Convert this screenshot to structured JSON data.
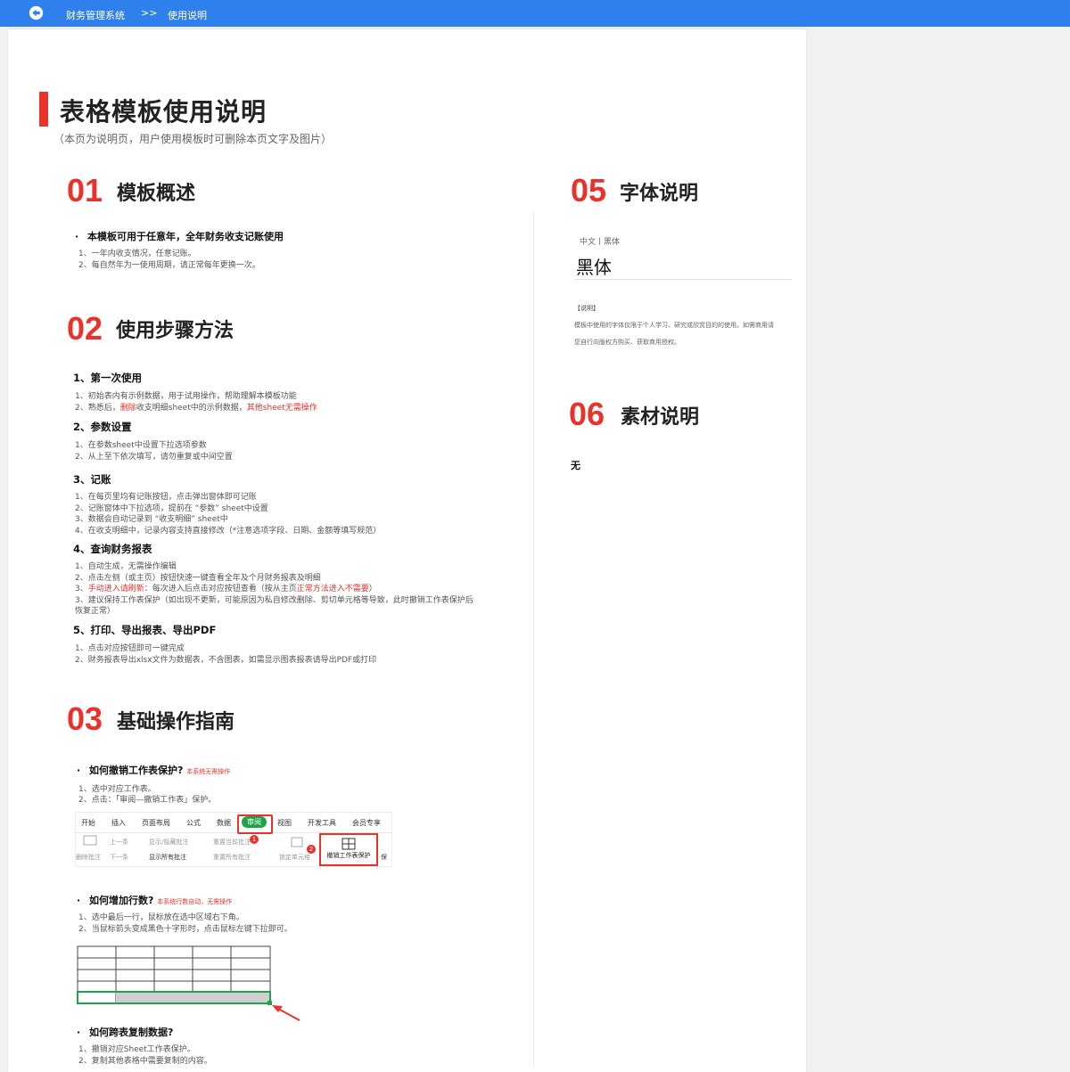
{
  "header": {
    "app_title": "财务管理系统",
    "separator": ">>",
    "current_page": "使用说明"
  },
  "page": {
    "title": "表格模板使用说明",
    "subtitle": "（本页为说明页，用户使用模板时可删除本页文字及图片）"
  },
  "sec01": {
    "num": "01",
    "title": "模板概述",
    "bullet": "本模板可用于任意年，全年财务收支记账使用",
    "lines": [
      "1、一年内收支情况，任意记账。",
      "2、每自然年为一使用周期，请正常每年更换一次。"
    ]
  },
  "sec02": {
    "num": "02",
    "title": "使用步骤方法",
    "s1": {
      "heading": "1、第一次使用",
      "l1": "1、初始表内有示例数据，用于试用操作，帮助理解本模板功能",
      "l2a": "2、熟悉后，",
      "l2b": "删除",
      "l2c": "收支明细sheet中的示例数据，",
      "l2d": "其他sheet无需操作"
    },
    "s2": {
      "heading": "2、参数设置",
      "lines": [
        "1、在参数sheet中设置下拉选项参数",
        "2、从上至下依次填写，请勿重复或中间空置"
      ]
    },
    "s3": {
      "heading": "3、记账",
      "lines": [
        "1、在每页里均有记账按钮，点击弹出窗体即可记账",
        "2、记账窗体中下拉选项，提前在 “参数” sheet中设置",
        "3、数据会自动记录到 “收支明细” sheet中",
        "4、在收支明细中，记录内容支持直接修改（*注意选项字段、日期、金额等填写规范）"
      ]
    },
    "s4": {
      "heading": "4、查询财务报表",
      "l1": "1、自动生成，无需操作编辑",
      "l2": "2、点击左侧（或主页）按钮快速一键查看全年及个月财务报表及明细",
      "l3a": "3、",
      "l3b": "手动进入请刷新",
      "l3c": "：每次进入后点击对应按钮查看（按从主页",
      "l3d": "正常方法进入不需要",
      "l3e": "）",
      "l4": "3、建议保持工作表保护（如出现不更新，可能原因为私自修改删除、剪切单元格等导致，此时撤销工作表保护后",
      "l5": "恢复正常）"
    },
    "s5": {
      "heading": "5、打印、导出报表、导出PDF",
      "lines": [
        "1、点击对应按钮即可一键完成",
        "2、财务报表导出xlsx文件为数据表，不含图表，如需显示图表报表请导出PDF或打印"
      ]
    }
  },
  "sec03": {
    "num": "03",
    "title": "基础操作指南",
    "q1": {
      "question": "如何撤销工作表保护?",
      "note": "本系统无需操作",
      "lines": [
        "1、选中对应工作表。",
        "2、点击：「审阅—撤销工作表」保护。"
      ]
    },
    "ribbon": {
      "tabs": [
        "开始",
        "插入",
        "页面布局",
        "公式",
        "数据",
        "审阅",
        "视图",
        "开发工具",
        "会员专享"
      ],
      "cmds": {
        "del": "删除批注",
        "prev": "上一条",
        "next": "下一条",
        "showhide": "显示/隐藏批注",
        "showall": "显示所有批注",
        "reset1": "重置当前批注",
        "resetall": "重置所有批注",
        "lockcell": "锁定单元格",
        "unprotect": "撤销工作表保护",
        "more": "保"
      },
      "badge1": "1",
      "badge2": "2"
    },
    "q2": {
      "question": "如何增加行数?",
      "note": "本系统行数自动，无需操作",
      "lines": [
        "1、选中最后一行，鼠标放在选中区域右下角。",
        "2、当鼠标箭头变成黑色十字形时，点击鼠标左键下拉即可。"
      ]
    },
    "q3": {
      "question": "如何跨表复制数据?",
      "lines": [
        "1、撤销对应Sheet工作表保护。",
        "2、复制其他表格中需要复制的内容。"
      ]
    }
  },
  "sec05": {
    "num": "05",
    "title": "字体说明",
    "font_label": "中文丨黑体",
    "font_sample": "黑体",
    "desc_heading": "【说明】",
    "desc_lines": [
      "模板中使用的字体仅限于个人学习、研究或欣赏目的的使用。如需商用请",
      "您自行向版权方购买、获取商用授权。"
    ]
  },
  "sec06": {
    "num": "06",
    "title": "素材说明",
    "body": "无"
  },
  "colors": {
    "topbar": "#2f80ec",
    "accent_red": "#e8322a",
    "green": "#1fa34a"
  }
}
